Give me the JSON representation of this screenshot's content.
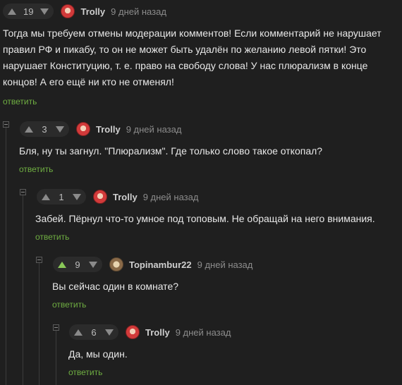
{
  "comments": [
    {
      "votes": "19",
      "user": "Trolly",
      "time": "9 дней назад",
      "text": "Тогда мы требуем отмены модерации комментов! Если комментарий не нарушает правил РФ и пикабу, то он не может быть удалён по желанию левой пятки! Это нарушает Конституцию, т. е. право на свободу слова! У нас плюрализм в конце концов! А его ещё ни кто не отменял!",
      "reply": "ответить",
      "avatar": "avatar-trolly",
      "upvoted": false
    },
    {
      "votes": "3",
      "user": "Trolly",
      "time": "9 дней назад",
      "text": "Бля, ну ты загнул. \"Плюрализм\". Где только слово такое откопал?",
      "reply": "ответить",
      "avatar": "avatar-trolly",
      "upvoted": false
    },
    {
      "votes": "1",
      "user": "Trolly",
      "time": "9 дней назад",
      "text": "Забей. Пёрнул что-то умное под топовым. Не обращай на него внимания.",
      "reply": "ответить",
      "avatar": "avatar-trolly",
      "upvoted": false
    },
    {
      "votes": "9",
      "user": "Topinambur22",
      "time": "9 дней назад",
      "text": "Вы сейчас один в комнате?",
      "reply": "ответить",
      "avatar": "avatar-topinambur",
      "upvoted": true
    },
    {
      "votes": "6",
      "user": "Trolly",
      "time": "9 дней назад",
      "text": "Да, мы один.",
      "reply": "ответить",
      "avatar": "avatar-trolly",
      "upvoted": false
    }
  ],
  "colors": {
    "background": "#1f1f1f",
    "reply_link": "#6fae42",
    "upvote_active": "#8ac858"
  }
}
